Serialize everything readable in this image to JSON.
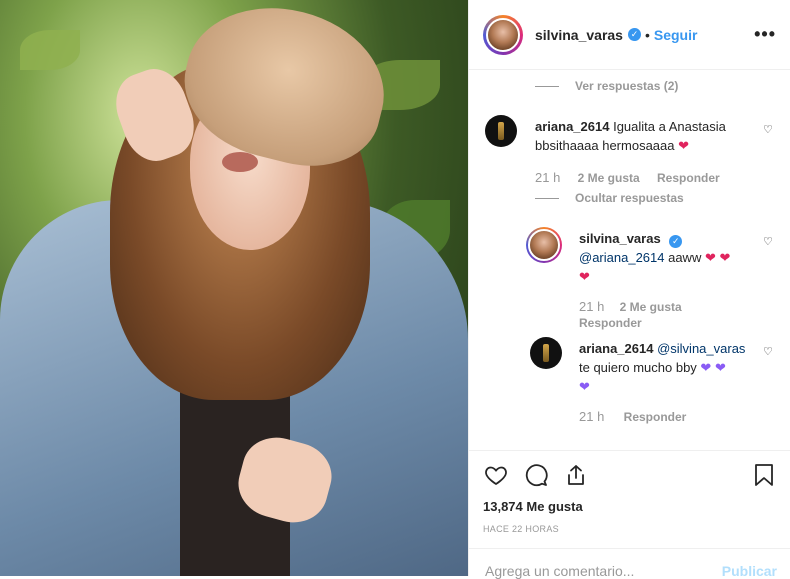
{
  "post": {
    "username": "silvina_varas",
    "follow_label": "Seguir",
    "separator": "•",
    "more_label": "•••"
  },
  "comments": {
    "view_replies": "Ver respuestas (2)",
    "hide_replies": "Ocultar respuestas",
    "c1": {
      "username": "ariana_2614",
      "text": "Igualita a Anastasia bbsithaaaa hermosaaaa",
      "time": "21 h",
      "likes": "2 Me gusta",
      "reply": "Responder"
    },
    "r1": {
      "username": "silvina_varas",
      "mention": "@ariana_2614",
      "text": " aaww",
      "time": "21 h",
      "likes": "2 Me gusta",
      "reply": "Responder"
    },
    "r2": {
      "username": "ariana_2614",
      "mention": "@silvina_varas",
      "text": "te quiero mucho bby",
      "time": "21 h",
      "reply": "Responder"
    }
  },
  "stats": {
    "likes": "13,874 Me gusta",
    "posted": "HACE 22 HORAS"
  },
  "composer": {
    "placeholder": "Agrega un comentario...",
    "publish": "Publicar"
  },
  "icons": [
    "heart-icon",
    "comment-icon",
    "share-icon",
    "bookmark-icon",
    "verified-icon",
    "more-icon"
  ],
  "colors": {
    "link": "#3897f0",
    "muted": "#999999",
    "red_heart": "#e0245e",
    "purple_heart": "#8a5cf5"
  }
}
